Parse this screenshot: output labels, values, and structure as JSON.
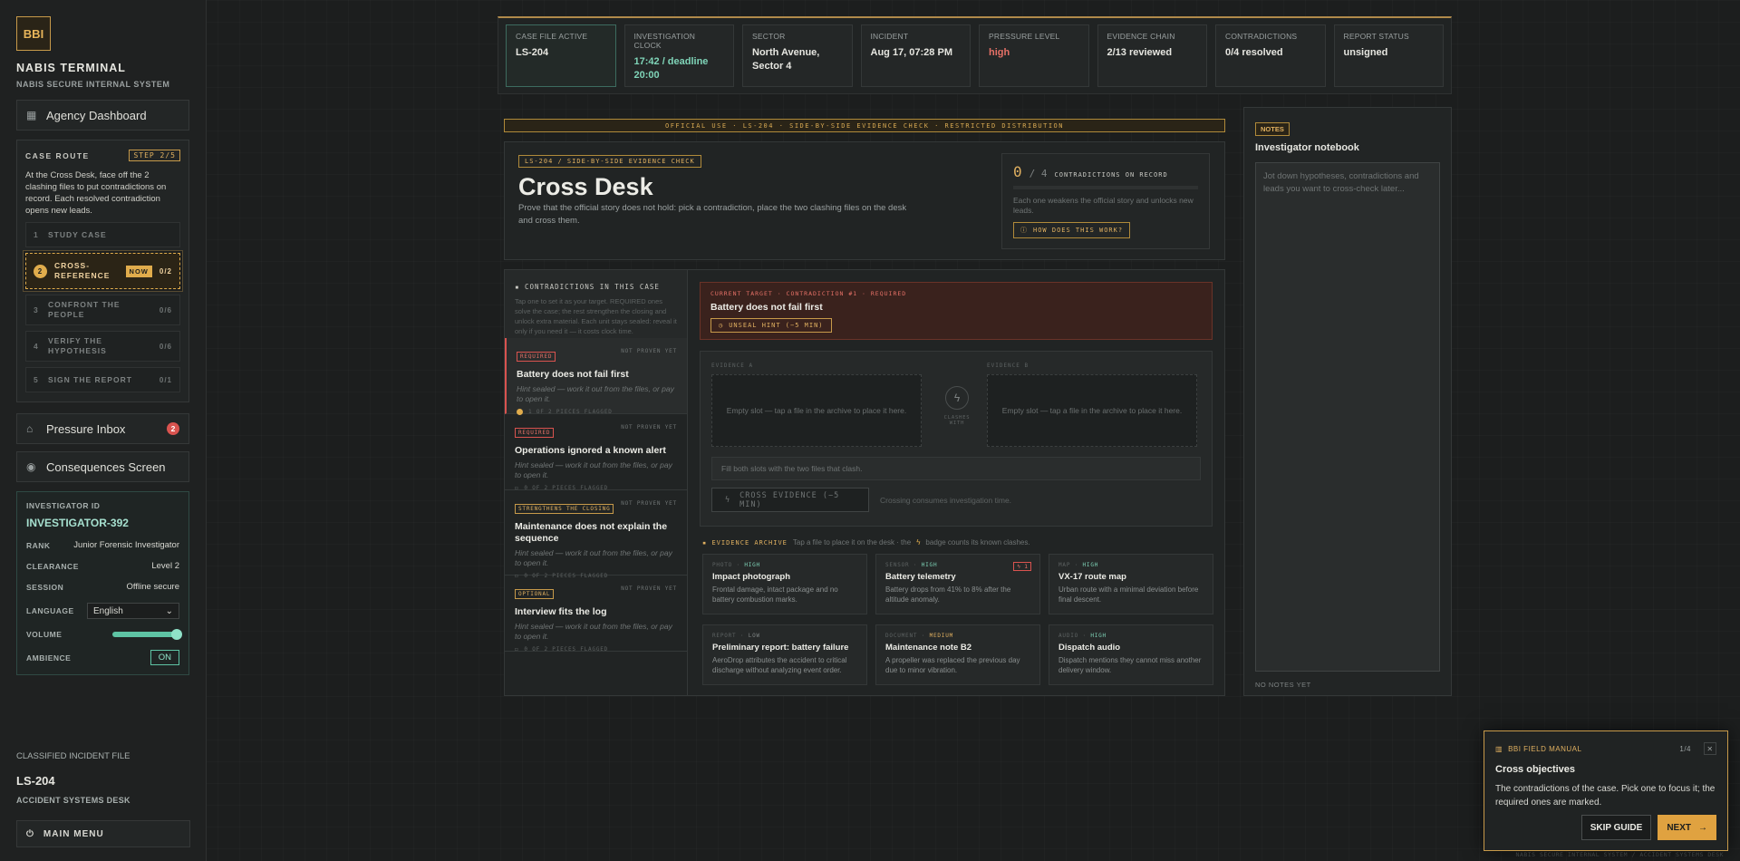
{
  "sidebar": {
    "logo": "BBI",
    "title": "NABIS TERMINAL",
    "subtitle": "NABIS SECURE INTERNAL SYSTEM",
    "dashboard": "Agency Dashboard",
    "route": {
      "title": "CASE ROUTE",
      "step": "STEP 2/5",
      "desc": "At the Cross Desk, face off the 2 clashing files to put contradictions on record. Each resolved contradiction opens new leads.",
      "items": [
        {
          "num": "1",
          "label": "STUDY CASE",
          "count": ""
        },
        {
          "num": "2",
          "label": "CROSS-REFERENCE",
          "badge": "NOW",
          "count": "0/2"
        },
        {
          "num": "3",
          "label": "CONFRONT THE PEOPLE",
          "count": "0/6"
        },
        {
          "num": "4",
          "label": "VERIFY THE HYPOTHESIS",
          "count": "0/6"
        },
        {
          "num": "5",
          "label": "SIGN THE REPORT",
          "count": "0/1"
        }
      ]
    },
    "inbox": "Pressure Inbox",
    "inbox_count": "2",
    "consequences": "Consequences Screen",
    "investigator": {
      "label": "INVESTIGATOR ID",
      "id": "INVESTIGATOR-392",
      "rank_k": "RANK",
      "rank_v": "Junior Forensic Investigator",
      "clearance_k": "CLEARANCE",
      "clearance_v": "Level 2",
      "session_k": "SESSION",
      "session_v": "Offline secure",
      "language_k": "LANGUAGE",
      "language_v": "English",
      "volume_k": "VOLUME",
      "ambience_k": "AMBIENCE",
      "ambience_v": "ON"
    },
    "file_label": "CLASSIFIED INCIDENT FILE",
    "file_id": "LS-204",
    "file_desk": "ACCIDENT SYSTEMS DESK",
    "main_menu": "MAIN MENU"
  },
  "status": [
    {
      "k": "CASE FILE ACTIVE",
      "v": "LS-204"
    },
    {
      "k": "INVESTIGATION CLOCK",
      "v": "17:42 / deadline 20:00"
    },
    {
      "k": "SECTOR",
      "v": "North Avenue, Sector 4"
    },
    {
      "k": "INCIDENT",
      "v": "Aug 17, 07:28 PM"
    },
    {
      "k": "PRESSURE LEVEL",
      "v": "high"
    },
    {
      "k": "EVIDENCE CHAIN",
      "v": "2/13 reviewed"
    },
    {
      "k": "CONTRADICTIONS",
      "v": "0/4 resolved"
    },
    {
      "k": "REPORT STATUS",
      "v": "unsigned"
    }
  ],
  "restricted": "OFFICIAL USE · LS-204 · SIDE-BY-SIDE EVIDENCE CHECK · RESTRICTED DISTRIBUTION",
  "hero": {
    "tag": "LS-204 / SIDE-BY-SIDE EVIDENCE CHECK",
    "title": "Cross Desk",
    "desc": "Prove that the official story does not hold: pick a contradiction, place the two clashing files on the desk and cross them.",
    "counter_num": "0",
    "counter_den": "/ 4",
    "counter_label": "CONTRADICTIONS ON RECORD",
    "counter_note": "Each one weakens the official story and unlocks new leads.",
    "how_btn": "HOW DOES THIS WORK?"
  },
  "contradictions": {
    "title": "CONTRADICTIONS IN THIS CASE",
    "desc": "Tap one to set it as your target. REQUIRED ones solve the case; the rest strengthen the closing and unlock extra material. Each unit stays sealed: reveal it only if you need it — it costs clock time.",
    "items": [
      {
        "tag": "REQUIRED",
        "state": "NOT PROVEN YET",
        "title": "Battery does not fail first",
        "hint": "Hint sealed — work it out from the files, or pay to open it.",
        "pieces": "1 OF 2 PIECES FLAGGED"
      },
      {
        "tag": "REQUIRED",
        "state": "NOT PROVEN YET",
        "title": "Operations ignored a known alert",
        "hint": "Hint sealed — work it out from the files, or pay to open it.",
        "pieces": "0 OF 2 PIECES FLAGGED"
      },
      {
        "tag": "STRENGTHENS THE CLOSING",
        "state": "NOT PROVEN YET",
        "title": "Maintenance does not explain the sequence",
        "hint": "Hint sealed — work it out from the files, or pay to open it.",
        "pieces": "0 OF 2 PIECES FLAGGED"
      },
      {
        "tag": "OPTIONAL",
        "state": "NOT PROVEN YET",
        "title": "Interview fits the log",
        "hint": "Hint sealed — work it out from the files, or pay to open it.",
        "pieces": "0 OF 2 PIECES FLAGGED"
      }
    ]
  },
  "target": {
    "label": "CURRENT TARGET · CONTRADICTION #1 · REQUIRED",
    "title": "Battery does not fail first",
    "unseal": "UNSEAL HINT (−5 MIN)"
  },
  "compare": {
    "slot_a_label": "EVIDENCE A",
    "slot_b_label": "EVIDENCE B",
    "slot_a": "Empty slot — tap a file in the archive to place it here.",
    "slot_b": "Empty slot — tap a file in the archive to place it here.",
    "mid_label": "CLASHES WITH",
    "fill_msg": "Fill both slots with the two files that clash.",
    "cross_btn": "CROSS EVIDENCE (−5 MIN)",
    "cross_note": "Crossing consumes investigation time."
  },
  "archive": {
    "title": "EVIDENCE ARCHIVE",
    "desc": "Tap a file to place it on the desk · the",
    "desc2": "badge counts its known clashes.",
    "cards": [
      {
        "type": "PHOTO",
        "weight": "HIGH",
        "title": "Impact photograph",
        "desc": "Frontal damage, intact package and no battery combustion marks.",
        "clash": ""
      },
      {
        "type": "SENSOR",
        "weight": "HIGH",
        "title": "Battery telemetry",
        "desc": "Battery drops from 41% to 8% after the altitude anomaly.",
        "clash": "1"
      },
      {
        "type": "MAP",
        "weight": "HIGH",
        "title": "VX-17 route map",
        "desc": "Urban route with a minimal deviation before final descent.",
        "clash": ""
      },
      {
        "type": "REPORT",
        "weight": "LOW",
        "title": "Preliminary report: battery failure",
        "desc": "AeroDrop attributes the accident to critical discharge without analyzing event order.",
        "clash": ""
      },
      {
        "type": "DOCUMENT",
        "weight": "MEDIUM",
        "title": "Maintenance note B2",
        "desc": "A propeller was replaced the previous day due to minor vibration.",
        "clash": ""
      },
      {
        "type": "AUDIO",
        "weight": "HIGH",
        "title": "Dispatch audio",
        "desc": "Dispatch mentions they cannot miss another delivery window.",
        "clash": ""
      }
    ]
  },
  "notes": {
    "tag": "NOTES",
    "title": "Investigator notebook",
    "placeholder": "Jot down hypotheses, contradictions and leads you want to cross-check later...",
    "footer": "NO NOTES YET"
  },
  "manual": {
    "head": "BBI FIELD MANUAL",
    "page": "1/4",
    "title": "Cross objectives",
    "text": "The contradictions of the case. Pick one to focus it; the required ones are marked.",
    "skip": "SKIP GUIDE",
    "next": "NEXT"
  },
  "footer_note": "NABIS SECURE INTERNAL SYSTEM / ACCIDENT SYSTEMS DESK"
}
